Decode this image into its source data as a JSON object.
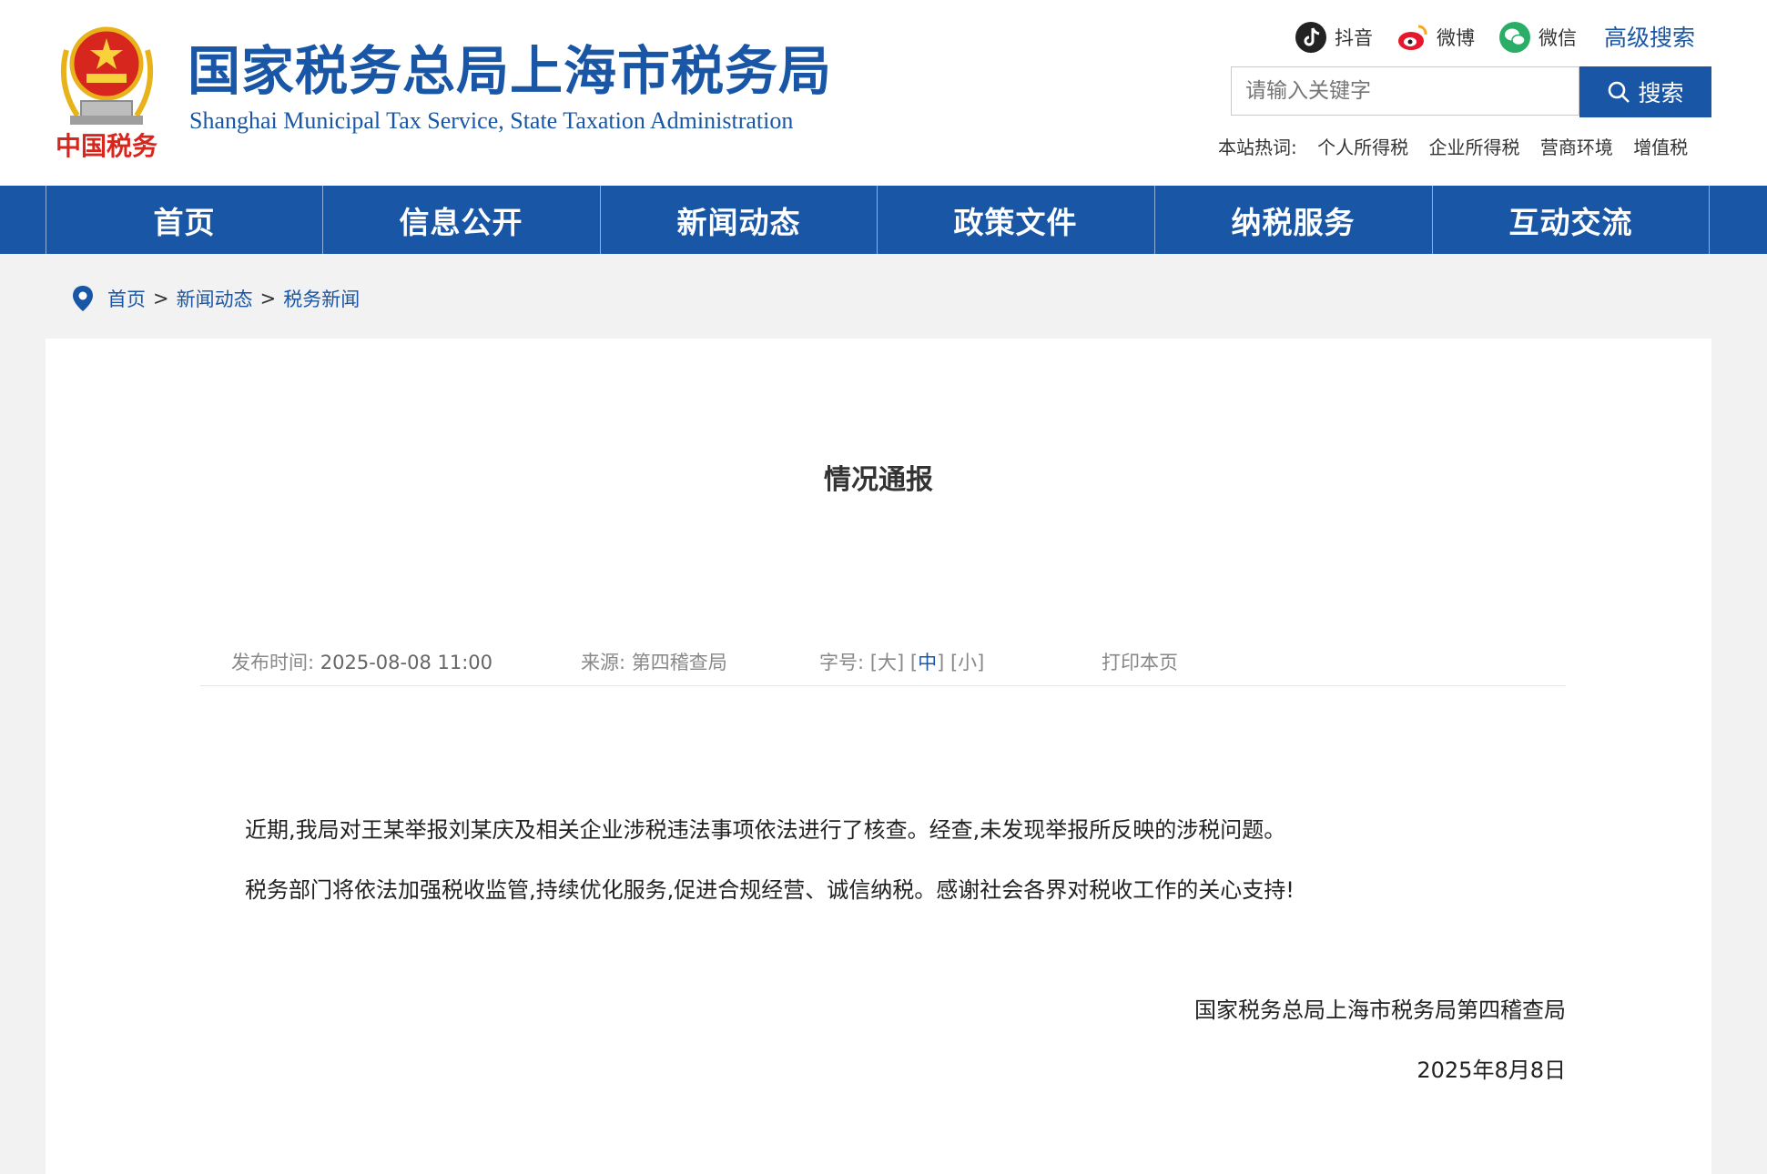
{
  "header": {
    "title_cn": "国家税务总局上海市税务局",
    "title_en": "Shanghai Municipal Tax Service, State Taxation Administration",
    "emblem_caption": "中国税务",
    "social": [
      {
        "label": "抖音",
        "icon": "douyin-icon"
      },
      {
        "label": "微博",
        "icon": "weibo-icon"
      },
      {
        "label": "微信",
        "icon": "wechat-icon"
      }
    ],
    "advanced_search": "高级搜索",
    "search_placeholder": "请输入关键字",
    "search_button": "搜索",
    "hot_label": "本站热词:",
    "hot_words": [
      "个人所得税",
      "企业所得税",
      "营商环境",
      "增值税"
    ]
  },
  "nav": {
    "items": [
      "首页",
      "信息公开",
      "新闻动态",
      "政策文件",
      "纳税服务",
      "互动交流"
    ]
  },
  "breadcrumb": {
    "items": [
      "首页",
      "新闻动态",
      "税务新闻"
    ],
    "separator": ">"
  },
  "article": {
    "title": "情况通报",
    "publish_label": "发布时间:",
    "publish_time": "2025-08-08 11:00",
    "source_label": "来源:",
    "source": "第四稽查局",
    "font_label": "字号:",
    "font_sizes": [
      "大",
      "中",
      "小"
    ],
    "font_selected": "中",
    "print": "打印本页",
    "paragraphs": [
      "近期,我局对王某举报刘某庆及相关企业涉税违法事项依法进行了核查。经查,未发现举报所反映的涉税问题。",
      "税务部门将依法加强税收监管,持续优化服务,促进合规经营、诚信纳税。感谢社会各界对税收工作的关心支持!"
    ],
    "signature": "国家税务总局上海市税务局第四稽查局",
    "date": "2025年8月8日"
  },
  "colors": {
    "brand_blue": "#1957a6",
    "page_bg": "#f2f2f2",
    "emblem_red": "#d7261e",
    "emblem_gold": "#e8b21b"
  }
}
